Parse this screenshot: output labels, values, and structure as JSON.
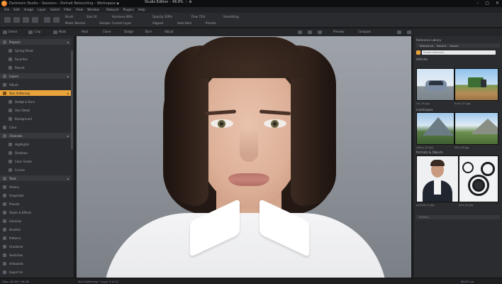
{
  "titlebar": {
    "title": "Darkroom Studio – Sessions – Portrait Retouching – Workspace  ▪",
    "right_text": "Studio Edition  ◦  66.8%  ⋮  ⚙",
    "btn_min": "–",
    "btn_max": "▢",
    "btn_close": "✕"
  },
  "menu": [
    "File",
    "Edit",
    "Image",
    "Layer",
    "Select",
    "Filter",
    "View",
    "Window",
    "Retouch",
    "Plugins",
    "Help"
  ],
  "options": {
    "row1": [
      "Brush",
      "Size 24",
      "Hardness 80%",
      "Opacity 100%",
      "Flow 72%",
      "Smoothing"
    ],
    "row2": [
      "Mode: Normal",
      "Sample: Current Layer",
      "Aligned",
      "Auto-Heal",
      "Presets"
    ]
  },
  "toolbar2": [
    "Select",
    "Crop",
    "Mask",
    "Heal",
    "Clone",
    "Dodge",
    "Burn",
    "Adjust",
    "Preview",
    "Compare"
  ],
  "left_panel": {
    "items": [
      {
        "label": "Projects",
        "type": "section"
      },
      {
        "label": "Spring Shoot",
        "type": "indent"
      },
      {
        "label": "Favorites",
        "type": "indent"
      },
      {
        "label": "Recent",
        "type": "indent"
      },
      {
        "label": "Layers",
        "type": "section"
      },
      {
        "label": "Adjust",
        "type": "item"
      },
      {
        "label": "Skin Softening",
        "type": "active"
      },
      {
        "label": "Dodge & Burn",
        "type": "indent"
      },
      {
        "label": "Hair Detail",
        "type": "indent"
      },
      {
        "label": "Background",
        "type": "indent"
      },
      {
        "label": "Color",
        "type": "item"
      },
      {
        "label": "Channels",
        "type": "section"
      },
      {
        "label": "Highlights",
        "type": "indent"
      },
      {
        "label": "Shadows",
        "type": "indent"
      },
      {
        "label": "Color Grade",
        "type": "indent"
      },
      {
        "label": "Curves",
        "type": "indent"
      },
      {
        "label": "Tools",
        "type": "section"
      },
      {
        "label": "History",
        "type": "item"
      },
      {
        "label": "Snapshots",
        "type": "item"
      },
      {
        "label": "Presets",
        "type": "item"
      },
      {
        "label": "Styles & Effects",
        "type": "item"
      },
      {
        "label": "Libraries",
        "type": "item"
      },
      {
        "label": "Brushes",
        "type": "item"
      },
      {
        "label": "Patterns",
        "type": "item"
      },
      {
        "label": "Gradients",
        "type": "item"
      },
      {
        "label": "Swatches",
        "type": "item"
      },
      {
        "label": "Artboards",
        "type": "item"
      },
      {
        "label": "Export As",
        "type": "item"
      }
    ]
  },
  "right_panel": {
    "header": "Reference Library",
    "tabs": [
      "Reference",
      "Recent",
      "Saved"
    ],
    "search_placeholder": "Search references",
    "section1": "Vehicles",
    "section2": "Landscapes",
    "section3": "Portraits & Objects",
    "captions": [
      "car_01.jpg",
      "truck_02.jpg",
      "valley_01.jpg",
      "hills_03.jpg",
      "portrait_m.jpg",
      "lens_kit.jpg"
    ],
    "footer": "6 items"
  },
  "statusbar": {
    "left": "Doc: 48.2M / 96.4M",
    "middle": "Skin Softening • Layer 3 of 12",
    "right": "66.8%   ◂ ▸"
  },
  "colors": {
    "accent": "#e8a33a",
    "bg": "#1b1c1e",
    "panel": "#2b2c2f"
  }
}
